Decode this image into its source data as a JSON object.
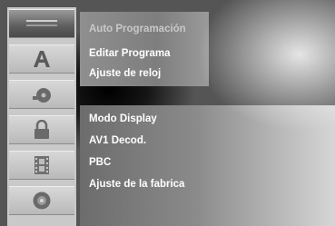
{
  "sidebar": {
    "items": [
      {
        "icon": "bars-icon",
        "selected": true
      },
      {
        "icon": "letter-a-icon",
        "selected": false
      },
      {
        "icon": "audio-disc-icon",
        "selected": false
      },
      {
        "icon": "lock-icon",
        "selected": false
      },
      {
        "icon": "film-icon",
        "selected": false
      },
      {
        "icon": "disc-icon",
        "selected": false
      }
    ]
  },
  "submenu": {
    "items": [
      {
        "label": "Auto Programación",
        "highlighted": true
      },
      {
        "label": "Editar Programa",
        "highlighted": false
      },
      {
        "label": "Ajuste de reloj",
        "highlighted": false
      }
    ]
  },
  "options": {
    "items": [
      {
        "label": "Modo Display"
      },
      {
        "label": "AV1 Decod."
      },
      {
        "label": "PBC"
      },
      {
        "label": "Ajuste de la fabrica"
      }
    ]
  },
  "colors": {
    "menu_text": "#ffffff",
    "highlight_text": "#c8c8c8",
    "sidebar_bg": "#c9c9c9",
    "selected_tab": "#5e5e5e"
  }
}
